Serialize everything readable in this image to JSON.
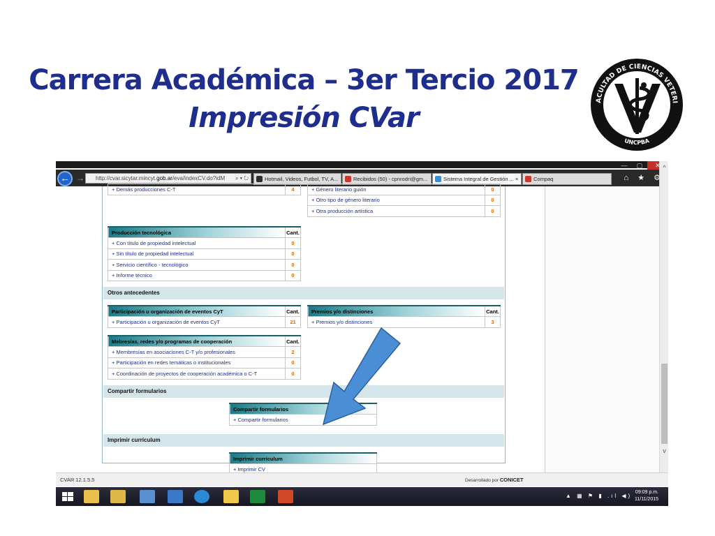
{
  "slide": {
    "title_line1": "Carrera Académica – 3er Tercio 2017",
    "title_line2": "Impresión CVar"
  },
  "logo": {
    "ring_text_top": "FACULTAD DE CIENCIAS VETERINARIAS",
    "ring_text_bottom": "UNCPBA"
  },
  "browser": {
    "address": {
      "prefix": "http://cvar.sicytar.mincyt.",
      "domain": "gob.ar",
      "suffix": "/eva/indexCV.do?idM"
    },
    "tabs": [
      {
        "label": "Hotmail, Videos, Futbol, TV, A...",
        "color": "#2e2e2e"
      },
      {
        "label": "Recibidos (50) - cpnrodri@gm...",
        "color": "#c8382c"
      },
      {
        "label": "Sistema Integral de Gestión ... ×",
        "color": "#3b8fd1"
      },
      {
        "label": "Compaq",
        "color": "#c8382c"
      }
    ],
    "window_buttons": [
      "—",
      "▢",
      "✕"
    ],
    "nav_icons": "⌂ ★ ⚙"
  },
  "cv": {
    "top_left_row": {
      "label": "+ Demás producciones C-T",
      "count": "4"
    },
    "top_right_rows": [
      {
        "label": "+ Género literario guión",
        "count": "0"
      },
      {
        "label": "+ Otro tipo de género literario",
        "count": "0"
      },
      {
        "label": "+ Otra producción artística",
        "count": "0"
      }
    ],
    "produccion": {
      "header": "Producción tecnológica",
      "count_header": "Cant.",
      "rows": [
        {
          "label": "+ Con título de propiedad intelectual",
          "count": "0"
        },
        {
          "label": "+ Sin título de propiedad intelectual",
          "count": "0"
        },
        {
          "label": "+ Servicio científico - tecnológico",
          "count": "0"
        },
        {
          "label": "+ Informe técnico",
          "count": "0"
        }
      ]
    },
    "otros_section": "Otros antecedentes",
    "participacion": {
      "header": "Participación u organización de eventos CyT",
      "count_header": "Cant.",
      "rows": [
        {
          "label": "+ Participación u organización de eventos CyT",
          "count": "21"
        }
      ]
    },
    "premios": {
      "header": "Premios y/o distinciones",
      "count_header": "Cant.",
      "rows": [
        {
          "label": "+ Premios y/o distinciones",
          "count": "3"
        }
      ]
    },
    "membresias": {
      "header": "Mebresías, redes y/o programas de cooperación",
      "count_header": "Cant.",
      "rows": [
        {
          "label": "+ Membresías en asociaciones C-T y/o profesionales",
          "count": "2"
        },
        {
          "label": "+ Participación en redes temáticas o institucionales",
          "count": "0"
        },
        {
          "label": "+ Coordinación de proyectos de cooperación académica o C-T",
          "count": "0"
        }
      ]
    },
    "compartir_section": "Compartir formularios",
    "compartir_box": {
      "header": "Compartir formularios",
      "row": "+ Compartir formularios"
    },
    "imprimir_section": "Imprimir currículum",
    "imprimir_box": {
      "header": "Imprimir currículum",
      "row": "+ Imprimir CV"
    }
  },
  "statusbar": {
    "version": "CVAR  12.1.5.5",
    "developed_by": "Desarrollado por",
    "developer": "CONICET"
  },
  "taskbar": {
    "time": "09:09 p.m.",
    "date": "11/11/2015",
    "tray": "▲ ▦ ⚑ ▮ .ıl ◀)",
    "apps": [
      {
        "name": "start",
        "color": "#ffffff"
      },
      {
        "name": "file-explorer",
        "color": "#e8c04a"
      },
      {
        "name": "library",
        "color": "#e0b84a"
      },
      {
        "name": "control-panel",
        "color": "#5a8fd0"
      },
      {
        "name": "chat",
        "color": "#3a78c8"
      },
      {
        "name": "internet-explorer",
        "color": "#2a8ad8"
      },
      {
        "name": "folder",
        "color": "#f0c84a"
      },
      {
        "name": "excel",
        "color": "#1d8a3d"
      },
      {
        "name": "powerpoint",
        "color": "#d24726"
      }
    ]
  },
  "colors": {
    "title": "#1f2d8c",
    "link": "#1e2f88",
    "count": "#e06a00",
    "header_start": "#1a7a86",
    "section_bg": "#d5e6ea",
    "arrow": "#4a8fd6"
  }
}
